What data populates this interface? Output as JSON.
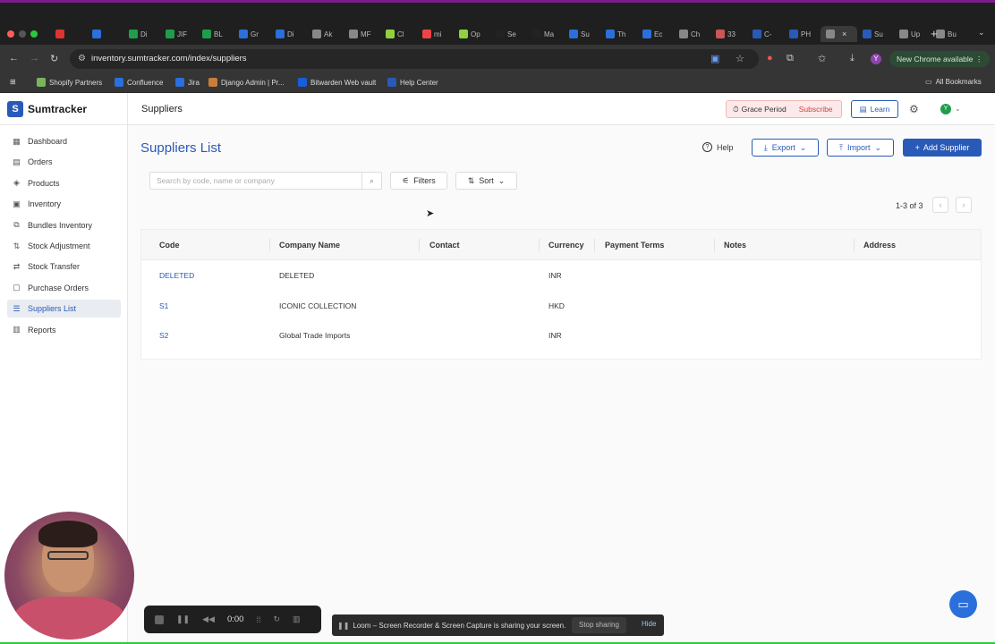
{
  "browser": {
    "url": "inventory.sumtracker.com/index/suppliers",
    "new_chrome_label": "New Chrome available",
    "tabs": [
      {
        "label": "",
        "color": "#d33"
      },
      {
        "label": "",
        "color": "#2a6fdb"
      },
      {
        "label": "Di",
        "color": "#1e9e4a"
      },
      {
        "label": "JIF",
        "color": "#1e9e4a"
      },
      {
        "label": "BL",
        "color": "#1e9e4a"
      },
      {
        "label": "Gr",
        "color": "#2a6fdb"
      },
      {
        "label": "Di",
        "color": "#2a6fdb"
      },
      {
        "label": "Ak",
        "color": "#888"
      },
      {
        "label": "MF",
        "color": "#888"
      },
      {
        "label": "Cl",
        "color": "#8fd13f"
      },
      {
        "label": "mi",
        "color": "#e44"
      },
      {
        "label": "Op",
        "color": "#8fd13f"
      },
      {
        "label": "Se",
        "color": "#222"
      },
      {
        "label": "Ma",
        "color": "#222"
      },
      {
        "label": "Su",
        "color": "#2a6fdb"
      },
      {
        "label": "Th",
        "color": "#2a6fdb"
      },
      {
        "label": "Ec",
        "color": "#2a6fdb"
      },
      {
        "label": "Ch",
        "color": "#888"
      },
      {
        "label": "33",
        "color": "#c55"
      },
      {
        "label": "C-",
        "color": "#2a5ab8"
      },
      {
        "label": "PH",
        "color": "#2a5ab8"
      },
      {
        "label": "",
        "color": "#888",
        "active": true
      },
      {
        "label": "Su",
        "color": "#2a5ab8"
      },
      {
        "label": "Up",
        "color": "#888"
      },
      {
        "label": "Bu",
        "color": "#888"
      }
    ],
    "bookmarks": [
      {
        "label": "Shopify Partners",
        "color": "#7ab55c"
      },
      {
        "label": "Confluence",
        "color": "#2a6fdb"
      },
      {
        "label": "Jira",
        "color": "#2a6fdb"
      },
      {
        "label": "Django Admin | Pr...",
        "color": "#c87d3a"
      },
      {
        "label": "Bitwarden Web vault",
        "color": "#175ddc"
      },
      {
        "label": "Help Center",
        "color": "#2a5ab8"
      }
    ],
    "all_bookmarks_label": "All Bookmarks"
  },
  "app": {
    "logo_letter": "S",
    "logo_text": "Sumtracker",
    "header_title": "Suppliers",
    "grace_label": "Grace Period",
    "subscribe_label": "Subscribe",
    "learn_label": "Learn",
    "avatar_letter": "Y"
  },
  "sidebar": {
    "items": [
      {
        "label": "Dashboard",
        "icon": "dashboard-icon",
        "glyph": "▦"
      },
      {
        "label": "Orders",
        "icon": "orders-icon",
        "glyph": "▤"
      },
      {
        "label": "Products",
        "icon": "products-icon",
        "glyph": "◈"
      },
      {
        "label": "Inventory",
        "icon": "inventory-icon",
        "glyph": "▣"
      },
      {
        "label": "Bundles Inventory",
        "icon": "bundles-icon",
        "glyph": "⧉"
      },
      {
        "label": "Stock Adjustment",
        "icon": "adjust-icon",
        "glyph": "⇅"
      },
      {
        "label": "Stock Transfer",
        "icon": "transfer-icon",
        "glyph": "⇄"
      },
      {
        "label": "Purchase Orders",
        "icon": "purchase-icon",
        "glyph": "▢"
      },
      {
        "label": "Suppliers List",
        "icon": "suppliers-icon",
        "glyph": "☰",
        "active": true
      },
      {
        "label": "Reports",
        "icon": "reports-icon",
        "glyph": "▥"
      }
    ]
  },
  "main": {
    "title": "Suppliers List",
    "help_label": "Help",
    "export_label": "Export",
    "import_label": "Import",
    "add_label": "Add Supplier",
    "search_placeholder": "Search by code, name or company",
    "filters_label": "Filters",
    "sort_label": "Sort",
    "pagination": "1-3 of 3",
    "columns": [
      "Code",
      "Company Name",
      "Contact",
      "Currency",
      "Payment Terms",
      "Notes",
      "Address"
    ],
    "rows": [
      {
        "code": "DELETED",
        "company": "DELETED",
        "contact": "",
        "currency": "INR",
        "terms": "",
        "notes": "",
        "address": ""
      },
      {
        "code": "S1",
        "company": "ICONIC COLLECTION",
        "contact": "",
        "currency": "HKD",
        "terms": "",
        "notes": "",
        "address": ""
      },
      {
        "code": "S2",
        "company": "Global Trade Imports",
        "contact": "",
        "currency": "INR",
        "terms": "",
        "notes": "",
        "address": ""
      }
    ]
  },
  "overlays": {
    "loom_time": "0:00",
    "share_text": "Loom – Screen Recorder & Screen Capture is sharing your screen.",
    "stop_label": "Stop sharing",
    "hide_label": "Hide"
  }
}
